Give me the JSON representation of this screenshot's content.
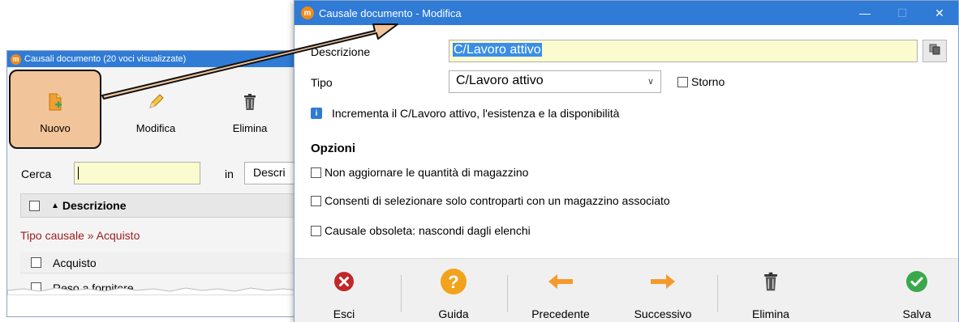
{
  "background_window": {
    "title": "Causali documento (20 voci visualizzate)",
    "toolbar": {
      "new_label": "Nuovo",
      "edit_label": "Modifica",
      "delete_label": "Elimina"
    },
    "search": {
      "label": "Cerca",
      "value": "",
      "in_label": "in",
      "field_value": "Descri"
    },
    "grid": {
      "column_header": "Descrizione",
      "group_label": "Tipo causale » Acquisto",
      "rows": [
        "Acquisto",
        "Reso a fornitore"
      ]
    }
  },
  "dialog": {
    "title": "Causale documento - Modifica",
    "fields": {
      "descrizione_label": "Descrizione",
      "descrizione_value": "C/Lavoro attivo",
      "tipo_label": "Tipo",
      "tipo_value": "C/Lavoro attivo",
      "storno_label": "Storno",
      "storno_checked": false
    },
    "info_text": "Incrementa il C/Lavoro attivo, l'esistenza e la disponibilità",
    "options_title": "Opzioni",
    "options": [
      {
        "label": "Non aggiornare le quantità di magazzino",
        "checked": false
      },
      {
        "label": "Consenti di selezionare solo controparti con un magazzino associato",
        "checked": false
      },
      {
        "label": "Causale obsoleta: nascondi dagli elenchi",
        "checked": false
      }
    ],
    "footer": {
      "exit_label": "Esci",
      "help_label": "Guida",
      "prev_label": "Precedente",
      "next_label": "Successivo",
      "delete_label": "Elimina",
      "save_label": "Salva"
    }
  },
  "colors": {
    "titlebar": "#2f7bd6",
    "highlight_fill": "#f2c49a",
    "input_bg": "#fbfbd0",
    "group_text": "#9b1c1c"
  }
}
